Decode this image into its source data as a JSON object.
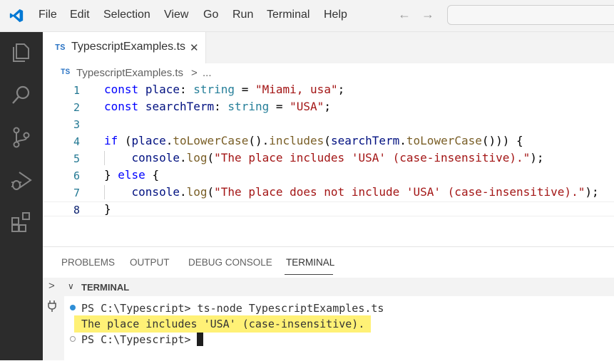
{
  "menubar": {
    "items": [
      "File",
      "Edit",
      "Selection",
      "View",
      "Go",
      "Run",
      "Terminal",
      "Help"
    ],
    "back_arrow": "←",
    "forward_arrow": "→"
  },
  "tab": {
    "badge": "TS",
    "filename": "TypescriptExamples.ts",
    "close": "✕"
  },
  "breadcrumb": {
    "badge": "TS",
    "file": "TypescriptExamples.ts",
    "sep": ">",
    "more": "..."
  },
  "code_lines": [
    {
      "n": "1",
      "text": "const place: string = \"Miami, usa\";"
    },
    {
      "n": "2",
      "text": "const searchTerm: string = \"USA\";"
    },
    {
      "n": "3",
      "text": ""
    },
    {
      "n": "4",
      "text": "if (place.toLowerCase().includes(searchTerm.toLowerCase())) {"
    },
    {
      "n": "5",
      "text": "    console.log(\"The place includes 'USA' (case-insensitive).\");"
    },
    {
      "n": "6",
      "text": "} else {"
    },
    {
      "n": "7",
      "text": "    console.log(\"The place does not include 'USA' (case-insensitive).\");"
    },
    {
      "n": "8",
      "text": "}"
    }
  ],
  "panel": {
    "tabs": [
      "PROBLEMS",
      "OUTPUT",
      "DEBUG CONSOLE",
      "TERMINAL"
    ],
    "active_tab": "TERMINAL",
    "section_title": "TERMINAL",
    "chevron": ">",
    "chevron_down": "∨"
  },
  "terminal": {
    "line1": "PS C:\\Typescript> ts-node TypescriptExamples.ts",
    "line2": "The place includes 'USA' (case-insensitive).",
    "line3": "PS C:\\Typescript> "
  },
  "colors": {
    "accent": "#007acc",
    "highlight": "#fff176",
    "activitybar": "#2c2c2c"
  }
}
